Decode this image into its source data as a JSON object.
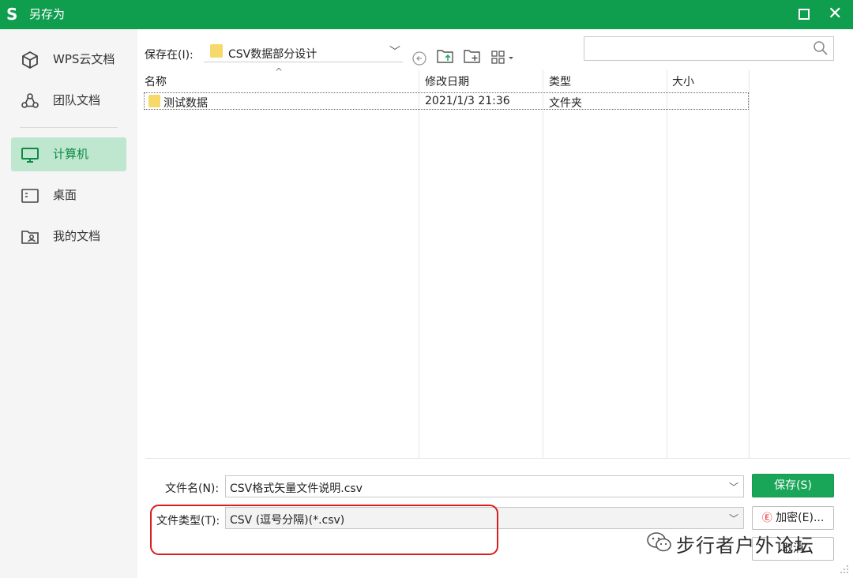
{
  "window": {
    "app_logo": "S",
    "title": "另存为",
    "icons": {
      "maximize": "maximize-icon",
      "close": "close-icon",
      "close_glyph": "✕"
    }
  },
  "sidebar": {
    "items": [
      {
        "label": "WPS云文档",
        "icon": "cloud-cube-icon",
        "active": false
      },
      {
        "label": "团队文档",
        "icon": "team-icon",
        "active": false
      },
      {
        "label": "计算机",
        "icon": "computer-icon",
        "active": true
      },
      {
        "label": "桌面",
        "icon": "desktop-icon",
        "active": false
      },
      {
        "label": "我的文档",
        "icon": "my-documents-icon",
        "active": false
      }
    ]
  },
  "toolbar": {
    "save_in_label": "保存在(I):",
    "location": "CSV数据部分设计",
    "back_icon": "back-icon",
    "up_folder_icon": "up-folder-icon",
    "new_folder_icon": "new-folder-icon",
    "view_menu_icon": "view-menu-icon",
    "search_placeholder": "",
    "search_icon": "search-icon"
  },
  "file_list": {
    "columns": [
      "名称",
      "修改日期",
      "类型",
      "大小"
    ],
    "rows": [
      {
        "name": "测试数据",
        "modified": "2021/1/3 21:36",
        "type": "文件夹",
        "size": ""
      }
    ]
  },
  "form": {
    "filename_label": "文件名(N):",
    "filename_value": "CSV格式矢量文件说明.csv",
    "filetype_label": "文件类型(T):",
    "filetype_value": "CSV (逗号分隔)(*.csv)"
  },
  "buttons": {
    "save": "保存(S)",
    "encrypt": "加密(E)...",
    "cancel": "取消"
  },
  "watermark": {
    "text": "步行者户外论坛"
  },
  "colors": {
    "title_bar": "#0f9d4e",
    "active_sidebar": "#bfe7cf",
    "save_button": "#1aa659",
    "highlight": "#d81e1e"
  }
}
